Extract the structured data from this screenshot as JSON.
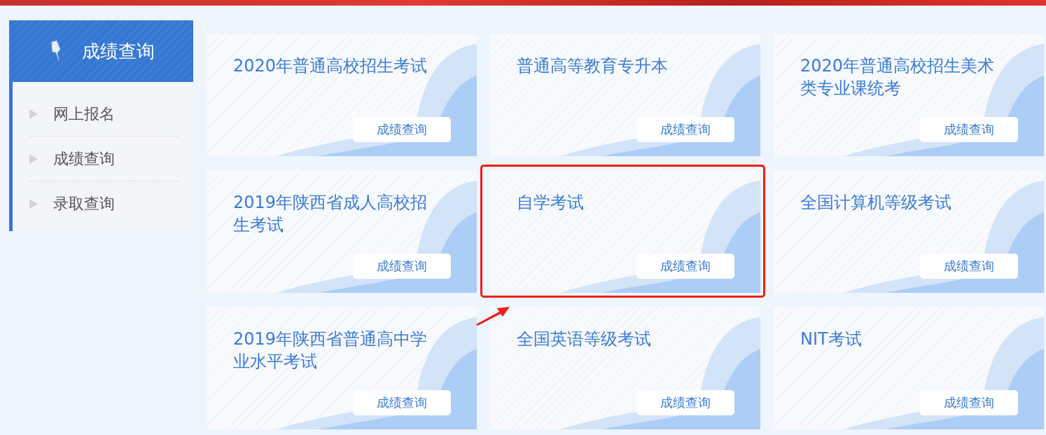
{
  "sidebar": {
    "title": "成绩查询",
    "items": [
      {
        "label": "网上报名"
      },
      {
        "label": "成绩查询"
      },
      {
        "label": "录取查询"
      }
    ]
  },
  "cards": [
    {
      "title": "2020年普通高校招生考试",
      "button": "成绩查询",
      "highlighted": false
    },
    {
      "title": "普通高等教育专升本",
      "button": "成绩查询",
      "highlighted": false
    },
    {
      "title": "2020年普通高校招生美术类专业课统考",
      "button": "成绩查询",
      "highlighted": false
    },
    {
      "title": "2019年陕西省成人高校招生考试",
      "button": "成绩查询",
      "highlighted": false
    },
    {
      "title": "自学考试",
      "button": "成绩查询",
      "highlighted": true
    },
    {
      "title": "全国计算机等级考试",
      "button": "成绩查询",
      "highlighted": false
    },
    {
      "title": "2019年陕西省普通高中学业水平考试",
      "button": "成绩查询",
      "highlighted": false
    },
    {
      "title": "全国英语等级考试",
      "button": "成绩查询",
      "highlighted": false
    },
    {
      "title": "NIT考试",
      "button": "成绩查询",
      "highlighted": false
    }
  ]
}
